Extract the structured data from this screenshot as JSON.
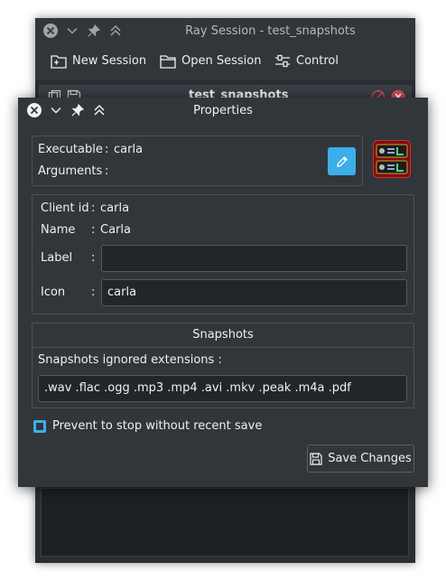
{
  "main_window": {
    "title": "Ray Session - test_snapshots",
    "toolbar": {
      "new_session": "New Session",
      "open_session": "Open Session",
      "control": "Control"
    },
    "session_name": "test_snapshots"
  },
  "dialog": {
    "title": "Properties",
    "executable_label": "Executable",
    "executable_sep": ":",
    "executable_value": "carla",
    "arguments_label": "Arguments",
    "arguments_sep": ":",
    "arguments_value": "",
    "client_id_label": "Client id",
    "client_id_sep": ":",
    "client_id_value": "carla",
    "name_label": "Name",
    "name_sep": ":",
    "name_value": "Carla",
    "label_label": "Label",
    "label_sep": ":",
    "label_value": "",
    "icon_label": "Icon",
    "icon_sep": ":",
    "icon_value": "carla",
    "snapshots_title": "Snapshots",
    "snapshots_ignored_label": "Snapshots ignored extensions :",
    "snapshots_ignored_value": ".wav .flac .ogg .mp3 .mp4 .avi .mkv .peak .m4a .pdf",
    "prevent_stop_label": "Prevent to stop without recent save",
    "prevent_stop_checked": true,
    "save_button": "Save Changes"
  },
  "colors": {
    "accent": "#3daee9",
    "window_bg": "#31363b",
    "field_bg": "#232629",
    "close_red": "#da4453"
  }
}
